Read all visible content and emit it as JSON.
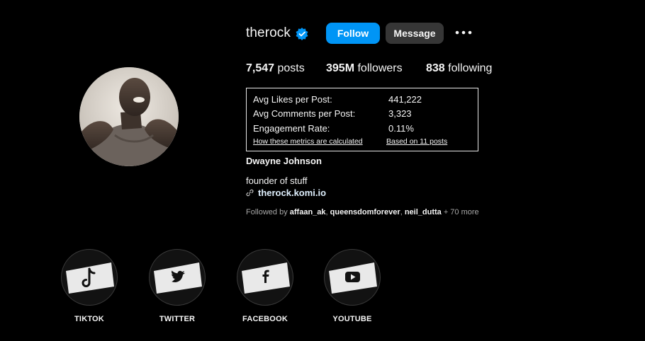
{
  "profile": {
    "username": "therock",
    "follow_label": "Follow",
    "message_label": "Message",
    "posts_count": "7,547",
    "posts_label": "posts",
    "followers_count": "395M",
    "followers_label": "followers",
    "following_count": "838",
    "following_label": "following",
    "full_name": "Dwayne Johnson",
    "bio": "founder of stuff",
    "link": "therock.komi.io",
    "followed_by_prefix": "Followed by",
    "followed_by": [
      "affaan_ak",
      "queensdomforever",
      "neil_dutta"
    ],
    "followed_by_more": "+ 70 more"
  },
  "metrics": {
    "rows": [
      {
        "label": "Avg Likes per Post:",
        "value": "441,222"
      },
      {
        "label": "Avg Comments per Post:",
        "value": "3,323"
      },
      {
        "label": "Engagement Rate:",
        "value": "0.11%"
      }
    ],
    "how_link": "How these metrics are calculated",
    "based_link": "Based on 11 posts"
  },
  "highlights": [
    {
      "label": "TIKTOK",
      "icon": "tiktok-icon"
    },
    {
      "label": "TWITTER",
      "icon": "twitter-icon"
    },
    {
      "label": "FACEBOOK",
      "icon": "facebook-icon"
    },
    {
      "label": "YOUTUBE",
      "icon": "youtube-icon"
    }
  ],
  "colors": {
    "background": "#000000",
    "follow_button": "#0095f6",
    "message_button": "#363636",
    "verified_badge": "#0095f6"
  }
}
